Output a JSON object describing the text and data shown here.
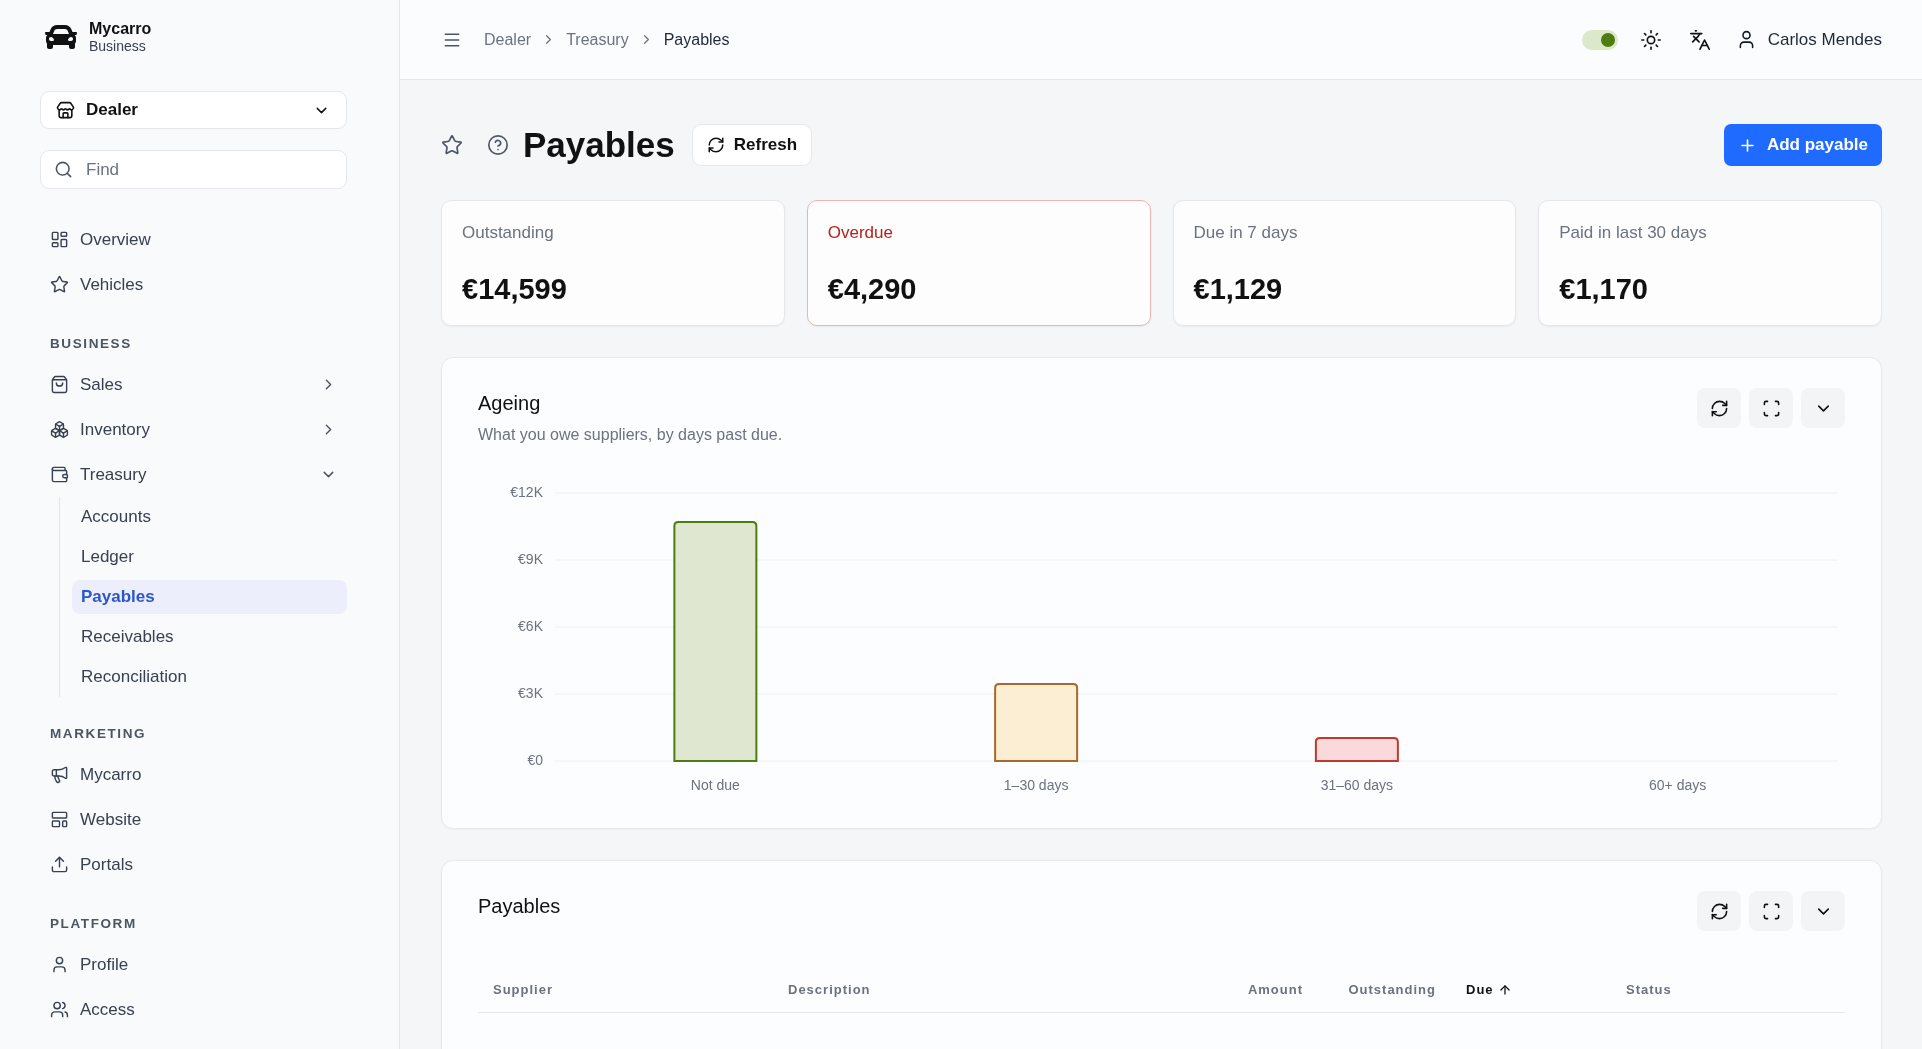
{
  "sidebar": {
    "brand": {
      "name": "Mycarro",
      "subtitle": "Business"
    },
    "workspace": {
      "value": "Dealer"
    },
    "search": {
      "placeholder": "Find"
    },
    "groups": [
      {
        "items": [
          {
            "label": "Overview",
            "selected": false
          },
          {
            "label": "Vehicles",
            "selected": false
          }
        ]
      },
      {
        "title": "BUSINESS",
        "items": [
          {
            "label": "Sales",
            "selected": false,
            "expanded": false
          },
          {
            "label": "Inventory",
            "selected": false,
            "expanded": false
          },
          {
            "label": "Treasury",
            "selected": false,
            "expanded": true,
            "children": [
              {
                "label": "Accounts",
                "selected": false
              },
              {
                "label": "Ledger",
                "selected": false
              },
              {
                "label": "Payables",
                "selected": true
              },
              {
                "label": "Receivables",
                "selected": false
              },
              {
                "label": "Reconciliation",
                "selected": false
              }
            ]
          }
        ]
      },
      {
        "title": "MARKETING",
        "items": [
          {
            "label": "Mycarro",
            "selected": false
          },
          {
            "label": "Website",
            "selected": false
          },
          {
            "label": "Portals",
            "selected": false
          }
        ]
      },
      {
        "title": "PLATFORM",
        "items": [
          {
            "label": "Profile",
            "selected": false
          },
          {
            "label": "Access",
            "selected": false
          }
        ]
      }
    ]
  },
  "header": {
    "breadcrumb": [
      "Dealer",
      "Treasury",
      "Payables"
    ],
    "switch": {
      "on": true
    },
    "user": "Carlos Mendes"
  },
  "page": {
    "title": "Payables",
    "starred": false,
    "refresh_button": "Refresh",
    "add_button": "Add payable"
  },
  "summary_cards": [
    {
      "label": "Outstanding",
      "value": "€14,599",
      "alert": false
    },
    {
      "label": "Overdue",
      "value": "€4,290",
      "alert": true
    },
    {
      "label": "Due in 7 days",
      "value": "€1,129",
      "alert": false
    },
    {
      "label": "Paid in last 30 days",
      "value": "€1,170",
      "alert": false
    }
  ],
  "ageing": {
    "title": "Ageing",
    "subtitle": "What you owe suppliers, by days past due.",
    "chart_data": {
      "type": "bar",
      "categories": [
        "Not due",
        "1–30 days",
        "31–60 days",
        "60+ days"
      ],
      "values": [
        10700,
        3450,
        1030,
        0
      ],
      "ylim": [
        0,
        12000
      ],
      "yticks": [
        {
          "value": 0,
          "label": "€0"
        },
        {
          "value": 3000,
          "label": "€3K"
        },
        {
          "value": 6000,
          "label": "€6K"
        },
        {
          "value": 9000,
          "label": "€9K"
        },
        {
          "value": 12000,
          "label": "€12K"
        }
      ],
      "grid": true
    }
  },
  "payables_table": {
    "title": "Payables",
    "columns": [
      {
        "label": "Supplier",
        "kind": "text",
        "sorted": false
      },
      {
        "label": "Description",
        "kind": "text",
        "sorted": false
      },
      {
        "label": "Amount",
        "kind": "number",
        "sorted": false
      },
      {
        "label": "Outstanding",
        "kind": "number",
        "sorted": false
      },
      {
        "label": "Due",
        "kind": "text",
        "sorted": true
      },
      {
        "label": "Status",
        "kind": "text",
        "sorted": false
      }
    ]
  }
}
